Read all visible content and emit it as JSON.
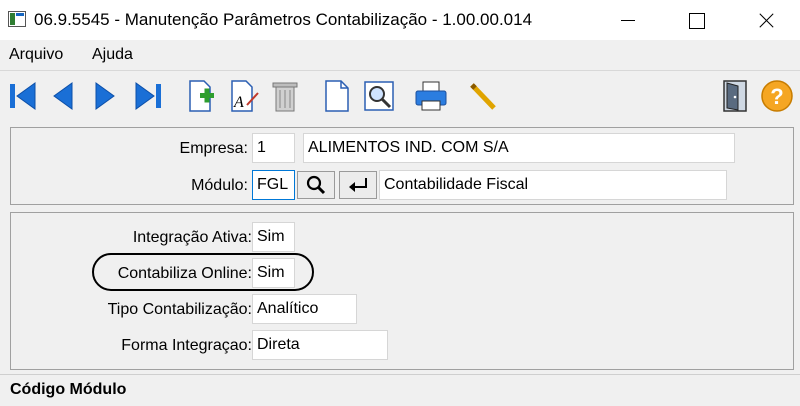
{
  "window": {
    "title": "06.9.5545 - Manutenção Parâmetros Contabilização - 1.00.00.014"
  },
  "menu": {
    "items": [
      "Arquivo",
      "Ajuda"
    ]
  },
  "toolbar": {
    "icons": [
      "first-record-icon",
      "previous-record-icon",
      "next-record-icon",
      "last-record-icon",
      "new-record-icon",
      "edit-record-icon",
      "delete-record-icon",
      "blank-document-icon",
      "preview-icon",
      "print-icon",
      "pencil-icon",
      "exit-door-icon",
      "help-icon"
    ]
  },
  "header": {
    "empresa_label": "Empresa:",
    "empresa_code": "1",
    "empresa_name": "ALIMENTOS IND. COM S/A",
    "modulo_label": "Módulo:",
    "modulo_code": "FGL",
    "modulo_name": "Contabilidade Fiscal"
  },
  "params": {
    "integracao_ativa_label": "Integração Ativa:",
    "integracao_ativa_value": "Sim",
    "contabiliza_online_label": "Contabiliza Online:",
    "contabiliza_online_value": "Sim",
    "tipo_contabilizacao_label": "Tipo Contabilização:",
    "tipo_contabilizacao_value": "Analítico",
    "forma_integracao_label": "Forma Integraçao:",
    "forma_integracao_value": "Direta"
  },
  "footer": {
    "status": "Código Módulo"
  },
  "colors": {
    "toolbar_blue": "#1a6fd6",
    "help_orange": "#f5a623",
    "focus_border": "#0078d7"
  }
}
